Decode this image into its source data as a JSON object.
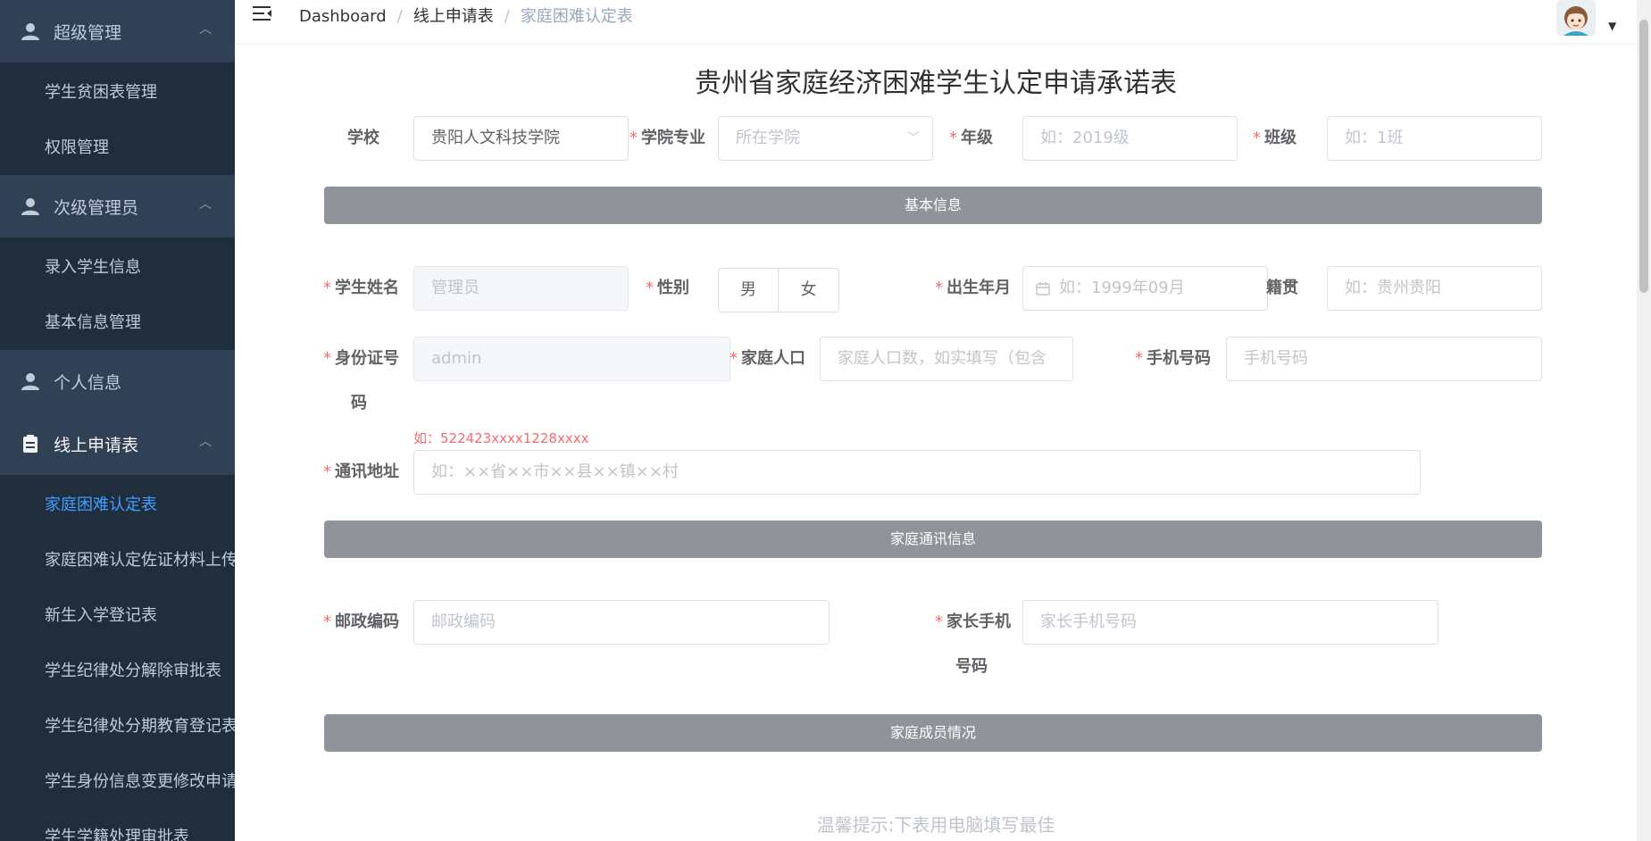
{
  "sidebar": {
    "groups": [
      {
        "label": "超级管理",
        "icon": "user-icon"
      },
      {
        "label": "次级管理员",
        "icon": "user-icon"
      },
      {
        "label": "个人信息",
        "icon": "user-icon"
      },
      {
        "label": "线上申请表",
        "icon": "clipboard-icon"
      }
    ],
    "items": [
      "学生贫困表管理",
      "权限管理",
      "录入学生信息",
      "基本信息管理",
      "家庭困难认定表",
      "家庭困难认定佐证材料上传",
      "新生入学登记表",
      "学生纪律处分解除审批表",
      "学生纪律处分期教育登记表",
      "学生身份信息变更修改申请表",
      "学生学籍处理审批表"
    ],
    "active_item": "家庭困难认定表",
    "colors": {
      "bg": "#1f2d3d",
      "group_bg": "#304156",
      "text": "#bfcbd9",
      "active": "#409eff"
    }
  },
  "header": {
    "breadcrumb": [
      "Dashboard",
      "线上申请表",
      "家庭困难认定表"
    ],
    "separator": "/"
  },
  "form": {
    "title": "贵州省家庭经济困难学生认定申请承诺表",
    "row1": {
      "school_label": "学校",
      "school_value": "贵阳人文科技学院",
      "major_label": "学院专业",
      "major_placeholder": "所在学院",
      "grade_label": "年级",
      "grade_placeholder": "如：2019级",
      "class_label": "班级",
      "class_placeholder": "如：1班"
    },
    "section1": "基本信息",
    "row2": {
      "name_label": "学生姓名",
      "name_placeholder": "管理员",
      "gender_label": "性别",
      "gender_options": [
        "男",
        "女"
      ],
      "birth_label": "出生年月",
      "birth_placeholder": "如：1999年09月",
      "native_label": "籍贯",
      "native_placeholder": "如：贵州贵阳"
    },
    "row3": {
      "id_label_line1": "身份证号",
      "id_label_line2": "码",
      "id_placeholder": "admin",
      "id_hint": "如：522423xxxx1228xxxx",
      "family_label": "家庭人口",
      "family_placeholder": "家庭人口数，如实填写（包含",
      "phone_label": "手机号码",
      "phone_placeholder": "手机号码"
    },
    "row4": {
      "address_label": "通讯地址",
      "address_placeholder": "如：××省××市××县××镇××村"
    },
    "section2": "家庭通讯信息",
    "row5": {
      "postcode_label": "邮政编码",
      "postcode_placeholder": "邮政编码",
      "parent_phone_label_line1": "家长手机",
      "parent_phone_label_line2": "号码",
      "parent_phone_placeholder": "家长手机号码"
    },
    "section3": "家庭成员情况",
    "tip": "温馨提示:下表用电脑填写最佳",
    "required_mark": "*"
  }
}
